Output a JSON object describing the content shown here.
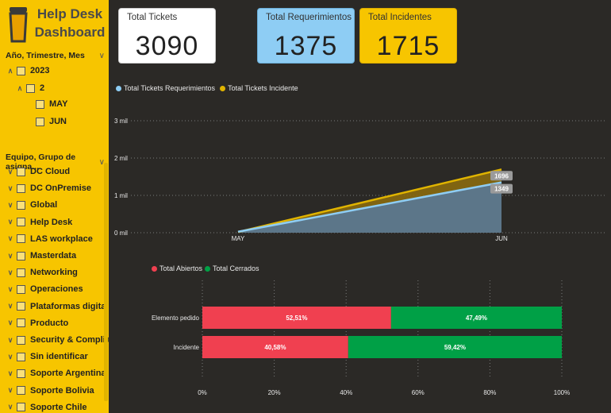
{
  "sidebar": {
    "title_line1": "Help Desk",
    "title_line2": "Dashboard",
    "logo_icon": "beer-glass-icon",
    "date_slicer": {
      "header": "Año, Trimestre, Mes",
      "items": [
        "2023",
        "2",
        "MAY",
        "JUN"
      ]
    },
    "team_slicer": {
      "header": "Equipo, Grupo de asigna...",
      "items": [
        "DC Cloud",
        "DC OnPremise",
        "Global",
        "Help Desk",
        "LAS workplace",
        "Masterdata",
        "Networking",
        "Operaciones",
        "Plataformas digital...",
        "Producto",
        "Security & Complia...",
        "Sin identificar",
        "Soporte Argentina",
        "Soporte Bolivia",
        "Soporte Chile"
      ]
    }
  },
  "cards": {
    "total": {
      "label": "Total Tickets",
      "value": "3090"
    },
    "requerimientos": {
      "label": "Total Requerimientos",
      "value": "1375"
    },
    "incidentes": {
      "label": "Total Incidentes",
      "value": "1715"
    }
  },
  "colors": {
    "sidebar": "#f7c500",
    "requerimientos_card": "#8ecdf4",
    "incidentes_card": "#f7c500",
    "line_requerimientos": "#8ecdf4",
    "line_incidente": "#e0b400",
    "abiertos": "#f04050",
    "cerrados": "#00a046"
  },
  "chart_data": [
    {
      "type": "area",
      "legend": [
        "Total Tickets Requerimientos",
        "Total Tickets Incidente"
      ],
      "categories": [
        "MAY",
        "JUN"
      ],
      "yticks": [
        "0 mil",
        "1 mil",
        "2 mil",
        "3 mil"
      ],
      "ylim": [
        0,
        3000
      ],
      "series": [
        {
          "name": "Total Tickets Requerimientos",
          "values": [
            26,
            1349
          ],
          "labels": [
            "",
            "1349"
          ]
        },
        {
          "name": "Total Tickets Incidente",
          "values": [
            19,
            1696
          ],
          "labels": [
            "",
            "1696"
          ]
        }
      ]
    },
    {
      "type": "bar",
      "stacked": "100%",
      "orientation": "horizontal",
      "legend": [
        "Total Abiertos",
        "Total Cerrados"
      ],
      "categories": [
        "Elemento pedido",
        "Incidente"
      ],
      "xticks": [
        "0%",
        "20%",
        "40%",
        "60%",
        "80%",
        "100%"
      ],
      "series": [
        {
          "name": "Total Abiertos",
          "values": [
            52.51,
            40.58
          ],
          "labels": [
            "52,51%",
            "40,58%"
          ]
        },
        {
          "name": "Total Cerrados",
          "values": [
            47.49,
            59.42
          ],
          "labels": [
            "47,49%",
            "59,42%"
          ]
        }
      ]
    }
  ]
}
